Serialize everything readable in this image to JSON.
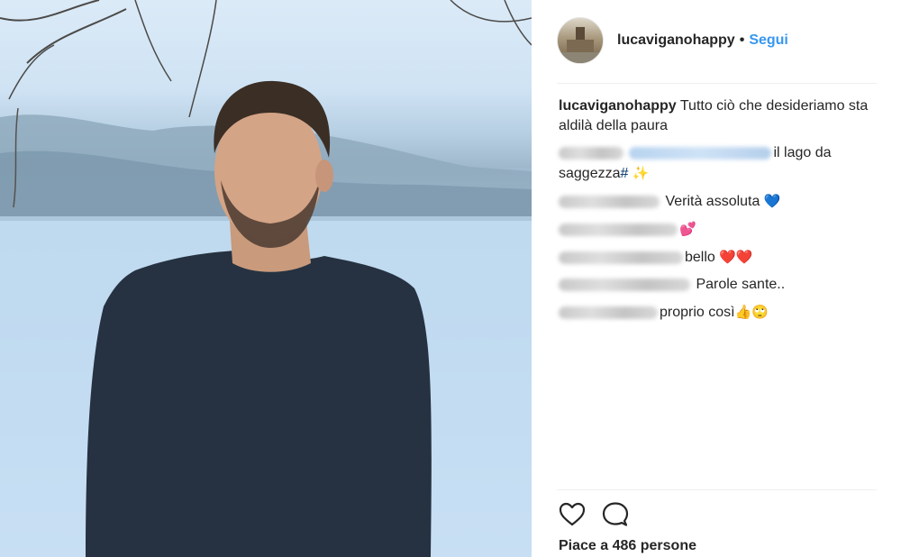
{
  "header": {
    "username": "lucaviganohappy",
    "separator": "•",
    "follow_label": "Segui"
  },
  "caption": {
    "username": "lucaviganohappy",
    "text": " Tutto ciò che desideriamo sta aldilà della paura"
  },
  "comments": [
    {
      "text": "il lago da saggezza",
      "hashtag": "#",
      "emoji": "✨"
    },
    {
      "text": " Verità assoluta ",
      "emoji": "💙"
    },
    {
      "text": "",
      "emoji": "💕"
    },
    {
      "text": "bello ",
      "emoji": "❤️❤️"
    },
    {
      "text": " Parole sante.."
    },
    {
      "text": "proprio così",
      "emoji": "👍🙄"
    }
  ],
  "actions": {
    "like_icon": "heart-icon",
    "comment_icon": "speech-bubble-icon"
  },
  "likes_text": "Piace a 486 persone"
}
